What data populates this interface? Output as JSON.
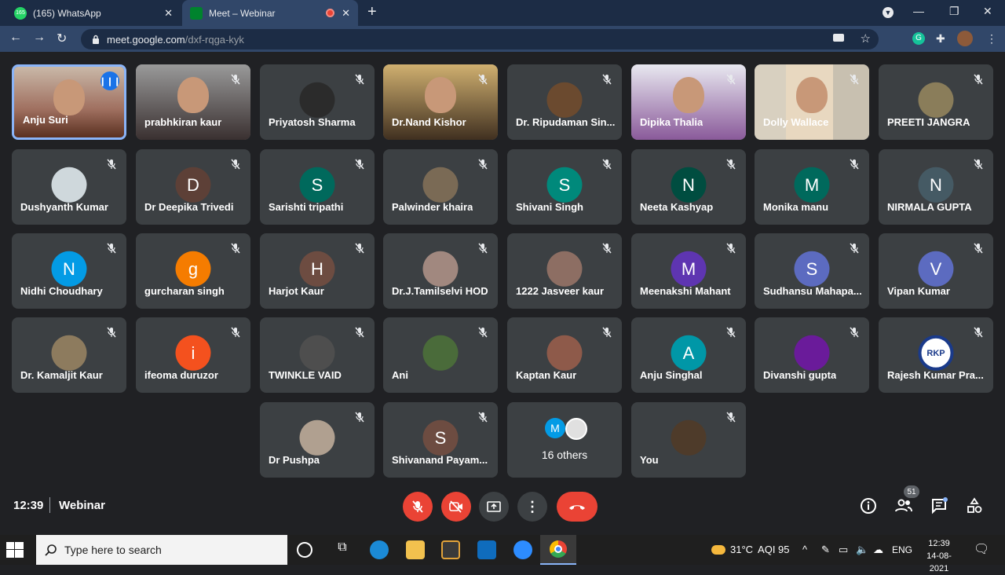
{
  "browser": {
    "tabs": [
      {
        "label": "(165) WhatsApp",
        "badge": "165",
        "icon": "whatsapp-icon"
      },
      {
        "label": "Meet – Webinar",
        "icon": "meet-icon",
        "recording": true
      }
    ],
    "url_host": "meet.google.com",
    "url_path": "/dxf-rqga-kyk"
  },
  "participants": [
    {
      "name": "Anju Suri",
      "video": true,
      "speaking": true,
      "muted": false
    },
    {
      "name": "prabhkiran kaur",
      "video": true
    },
    {
      "name": "Priyatosh Sharma",
      "avatar_color": "#2b2b2b",
      "initial": ""
    },
    {
      "name": "Dr.Nand Kishor",
      "video": true
    },
    {
      "name": "Dr. Ripudaman Sin...",
      "avatar_color": "#6b4a2f",
      "initial": ""
    },
    {
      "name": "Dipika Thalia",
      "video": true
    },
    {
      "name": "Dolly Wallace",
      "video": true
    },
    {
      "name": "PREETI JANGRA",
      "avatar_color": "#8a7d5a",
      "initial": ""
    },
    {
      "name": "Dushyanth Kumar",
      "avatar_color": "#cfd8dc",
      "initial": ""
    },
    {
      "name": "Dr Deepika Trivedi",
      "avatar_color": "#5d4037",
      "initial": "D"
    },
    {
      "name": "Sarishti tripathi",
      "avatar_color": "#00695c",
      "initial": "S"
    },
    {
      "name": "Palwinder khaira",
      "avatar_color": "#7a6a55",
      "initial": ""
    },
    {
      "name": "Shivani Singh",
      "avatar_color": "#00897b",
      "initial": "S"
    },
    {
      "name": "Neeta Kashyap",
      "avatar_color": "#004d40",
      "initial": "N"
    },
    {
      "name": "Monika manu",
      "avatar_color": "#00695c",
      "initial": "M"
    },
    {
      "name": "NIRMALA GUPTA",
      "avatar_color": "#455a64",
      "initial": "N"
    },
    {
      "name": "Nidhi Choudhary",
      "avatar_color": "#039be5",
      "initial": "N"
    },
    {
      "name": "gurcharan singh",
      "avatar_color": "#f57c00",
      "initial": "g"
    },
    {
      "name": "Harjot Kaur",
      "avatar_color": "#6d4c41",
      "initial": "H"
    },
    {
      "name": "Dr.J.Tamilselvi HOD",
      "avatar_color": "#a1887f",
      "initial": ""
    },
    {
      "name": "1222 Jasveer kaur",
      "avatar_color": "#8d6e63",
      "initial": ""
    },
    {
      "name": "Meenakshi Mahant",
      "avatar_color": "#5e35b1",
      "initial": "M"
    },
    {
      "name": "Sudhansu Mahapa...",
      "avatar_color": "#5c6bc0",
      "initial": "S"
    },
    {
      "name": "Vipan Kumar",
      "avatar_color": "#5c6bc0",
      "initial": "V"
    },
    {
      "name": "Dr. Kamaljit Kaur",
      "avatar_color": "#8d7b5e",
      "initial": ""
    },
    {
      "name": "ifeoma duruzor",
      "avatar_color": "#f4511e",
      "initial": "i"
    },
    {
      "name": "TWINKLE VAID",
      "avatar_color": "#4e4e4e",
      "initial": ""
    },
    {
      "name": "Ani",
      "avatar_color": "#4a6b3a",
      "initial": ""
    },
    {
      "name": "Kaptan Kaur",
      "avatar_color": "#8e5a4a",
      "initial": ""
    },
    {
      "name": "Anju Singhal",
      "avatar_color": "#0097a7",
      "initial": "A"
    },
    {
      "name": "Divanshi gupta",
      "avatar_color": "#6a1b9a",
      "initial": ""
    },
    {
      "name": "Rajesh Kumar Pra...",
      "avatar_color": "#ffffff",
      "initial": "RKP"
    },
    {
      "name": "Dr Pushpa",
      "avatar_color": "#b0a090",
      "initial": ""
    },
    {
      "name": "Shivanand Payam...",
      "avatar_color": "#6d4c41",
      "initial": "S"
    },
    {
      "name": "16 others",
      "others": true,
      "initial": "M"
    },
    {
      "name": "You",
      "avatar_color": "#4e3b2a",
      "initial": ""
    }
  ],
  "meeting": {
    "time": "12:39",
    "title": "Webinar",
    "participant_count": "51"
  },
  "taskbar": {
    "search_placeholder": "Type here to search",
    "temperature": "31°C",
    "aqi": "AQI 95",
    "language": "ENG",
    "time": "12:39",
    "date": "14-08-2021"
  }
}
